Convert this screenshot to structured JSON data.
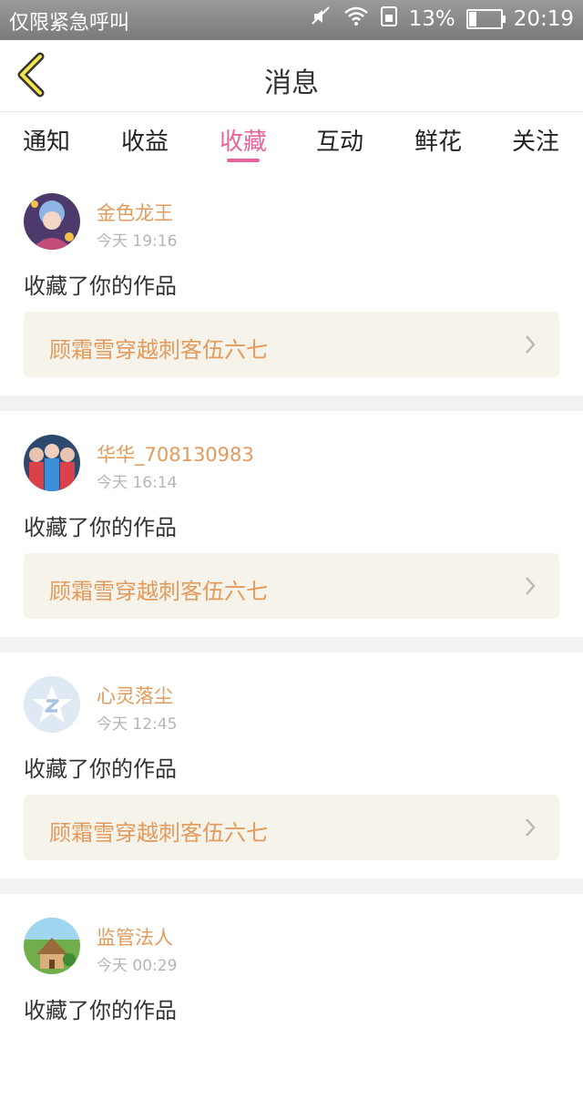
{
  "status_bar": {
    "carrier": "仅限紧急呼叫",
    "battery": "13%",
    "time": "20:19"
  },
  "header": {
    "title": "消息",
    "back_icon": "back-chevron-icon"
  },
  "tabs": [
    {
      "label": "通知",
      "active": false
    },
    {
      "label": "收益",
      "active": false
    },
    {
      "label": "收藏",
      "active": true
    },
    {
      "label": "互动",
      "active": false
    },
    {
      "label": "鲜花",
      "active": false
    },
    {
      "label": "关注",
      "active": false
    }
  ],
  "colors": {
    "accent": "#e8649a",
    "name": "#e39a5b",
    "work_bg": "#f5f3ea"
  },
  "items": [
    {
      "name": "金色龙王",
      "time": "今天 19:16",
      "action": "收藏了你的作品",
      "work": "顾霜雪穿越刺客伍六七",
      "avatar": "anime-character-avatar"
    },
    {
      "name": "华华_708130983",
      "time": "今天 16:14",
      "action": "收藏了你的作品",
      "work": "顾霜雪穿越刺客伍六七",
      "avatar": "group-photo-avatar"
    },
    {
      "name": "心灵落尘",
      "time": "今天 12:45",
      "action": "收藏了你的作品",
      "work": "顾霜雪穿越刺客伍六七",
      "avatar": "default-star-avatar"
    },
    {
      "name": "监管法人",
      "time": "今天 00:29",
      "action": "收藏了你的作品",
      "work": "",
      "avatar": "landscape-house-avatar"
    }
  ]
}
